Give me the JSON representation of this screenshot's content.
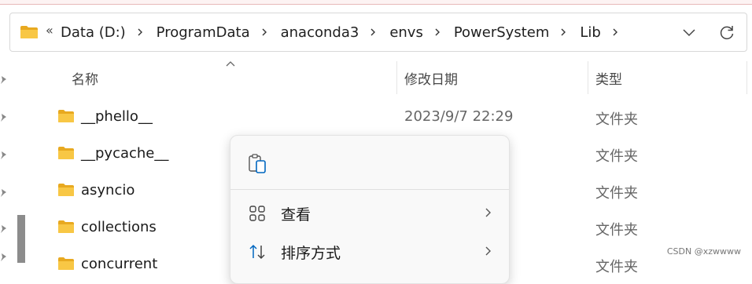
{
  "address": {
    "overflow_glyph": "«",
    "breadcrumbs": [
      "Data (D:)",
      "ProgramData",
      "anaconda3",
      "envs",
      "PowerSystem",
      "Lib"
    ]
  },
  "columns": {
    "name": "名称",
    "date": "修改日期",
    "type": "类型"
  },
  "rows": [
    {
      "name": "__phello__",
      "date": "2023/9/7 22:29",
      "type": "文件夹"
    },
    {
      "name": "__pycache__",
      "date": "",
      "type": "文件夹"
    },
    {
      "name": "asyncio",
      "date": "",
      "type": "文件夹"
    },
    {
      "name": "collections",
      "date": "",
      "type": "文件夹"
    },
    {
      "name": "concurrent",
      "date": "",
      "type": "文件夹"
    }
  ],
  "context_menu": {
    "items": [
      {
        "label": "查看",
        "icon": "grid-view-icon",
        "has_submenu": true
      },
      {
        "label": "排序方式",
        "icon": "sort-icon",
        "has_submenu": true
      }
    ]
  },
  "watermark": "CSDN @xzwwww",
  "colors": {
    "folder": "#f8c745",
    "folder_dark": "#e8a920",
    "accent_blue": "#0067c0"
  }
}
